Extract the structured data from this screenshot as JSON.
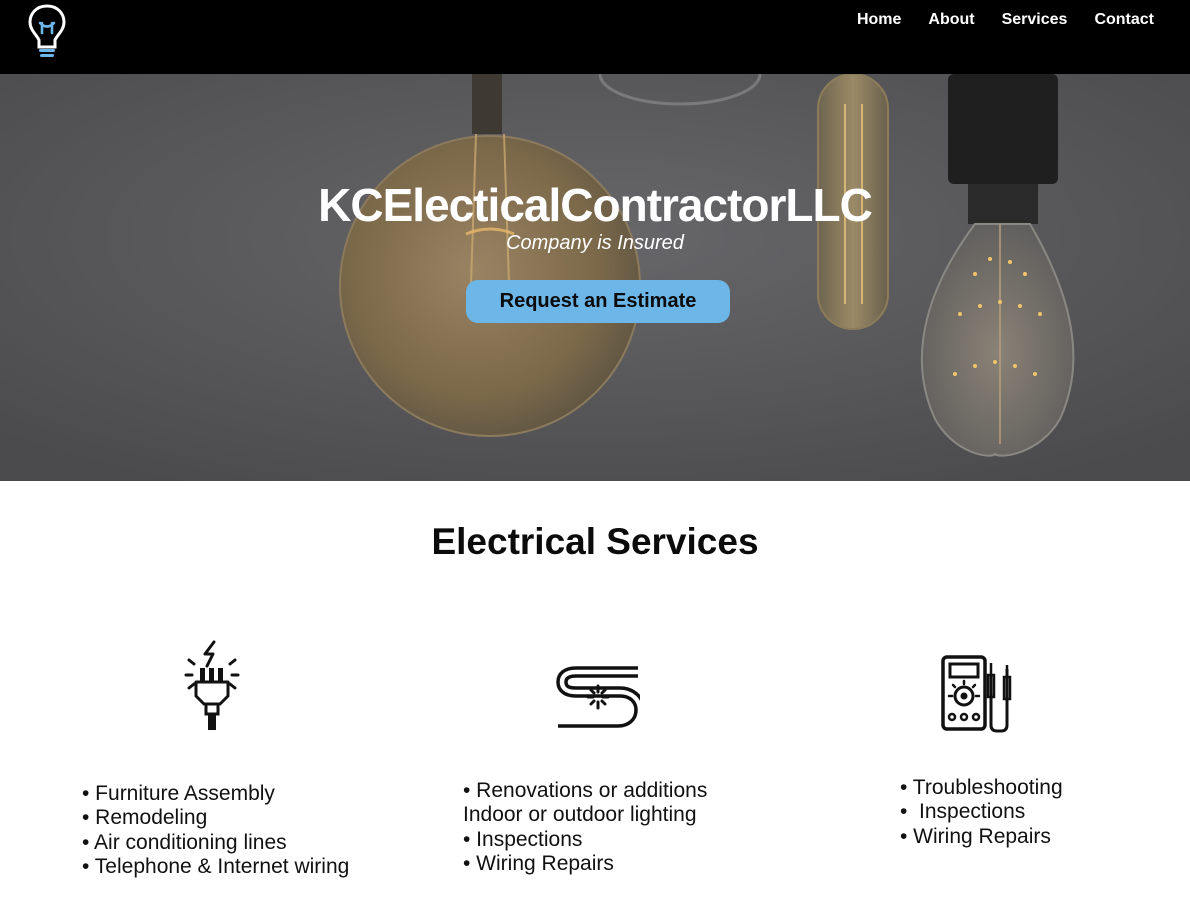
{
  "nav": {
    "logo_icon": "lightbulb-icon",
    "links": [
      "Home",
      "About",
      "Services",
      "Contact"
    ]
  },
  "hero": {
    "title": "KCElecticalContractorLLC",
    "subtitle": "Company is Insured",
    "button_label": "Request an Estimate"
  },
  "services": {
    "heading": "Electrical Services",
    "columns": [
      {
        "icon": "electric-plug-icon",
        "items": [
          "• Furniture Assembly",
          "• Remodeling",
          "• Air conditioning lines",
          "• Telephone & Internet wiring"
        ]
      },
      {
        "icon": "wire-cable-icon",
        "items": [
          "• Renovations or additions",
          "Indoor or outdoor lighting",
          "• Inspections",
          "• Wiring Repairs"
        ]
      },
      {
        "icon": "multimeter-icon",
        "items": [
          "• Troubleshooting",
          "•  Inspections",
          "• Wiring Repairs"
        ]
      }
    ]
  },
  "colors": {
    "nav_bg": "#000000",
    "accent": "#6cb6e8",
    "hero_bg": "#58585a"
  }
}
